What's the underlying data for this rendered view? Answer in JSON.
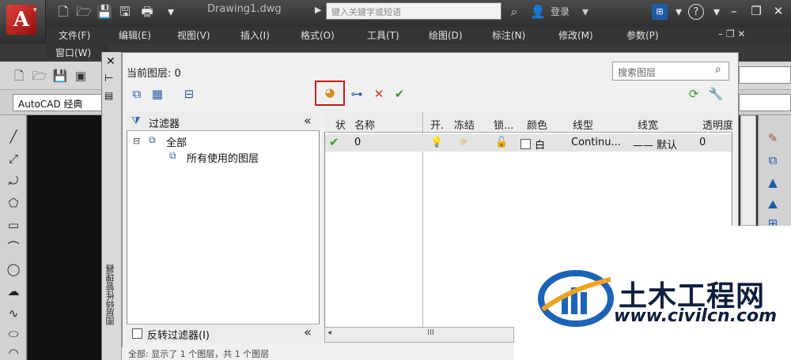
{
  "window": {
    "doc_title": "Drawing1.dwg",
    "search_placeholder": "键入关键字或短语",
    "user_label": "登录",
    "app_logo": "A",
    "help": "?"
  },
  "menu": {
    "items": [
      "文件(F)",
      "编辑(E)",
      "视图(V)",
      "插入(I)",
      "格式(O)",
      "工具(T)",
      "绘图(D)",
      "标注(N)",
      "修改(M)",
      "参数(P)"
    ],
    "second_row": "窗口(W)"
  },
  "toolbar": {
    "workspace": "AutoCAD 经典"
  },
  "palette": {
    "current_layer": "当前图层: 0",
    "search_placeholder": "搜索图层",
    "strip_title": "图层特性管理器",
    "filter_header": "过滤器",
    "tree_all": "全部",
    "tree_used": "所有使用的图层",
    "invert_filter": "反转过滤器(I)",
    "collapse": "«",
    "columns": [
      "状",
      "名称",
      "开.",
      "冻结",
      "锁...",
      "颜色",
      "线型",
      "线宽",
      "透明度"
    ],
    "row": {
      "name": "0",
      "color": "白",
      "linetype": "Continu...",
      "lineweight": "—— 默认",
      "transparency": "0"
    },
    "scroll_mark": "III",
    "status": "全部: 显示了 1 个图层，共 1 个图层"
  },
  "watermark": {
    "title": "土木工程网",
    "url": "www.civilcn.com"
  },
  "colors": {
    "highlight_box": "#d21818",
    "brand_red": "#c8201b",
    "watermark_blue": "#0e1e3c"
  }
}
